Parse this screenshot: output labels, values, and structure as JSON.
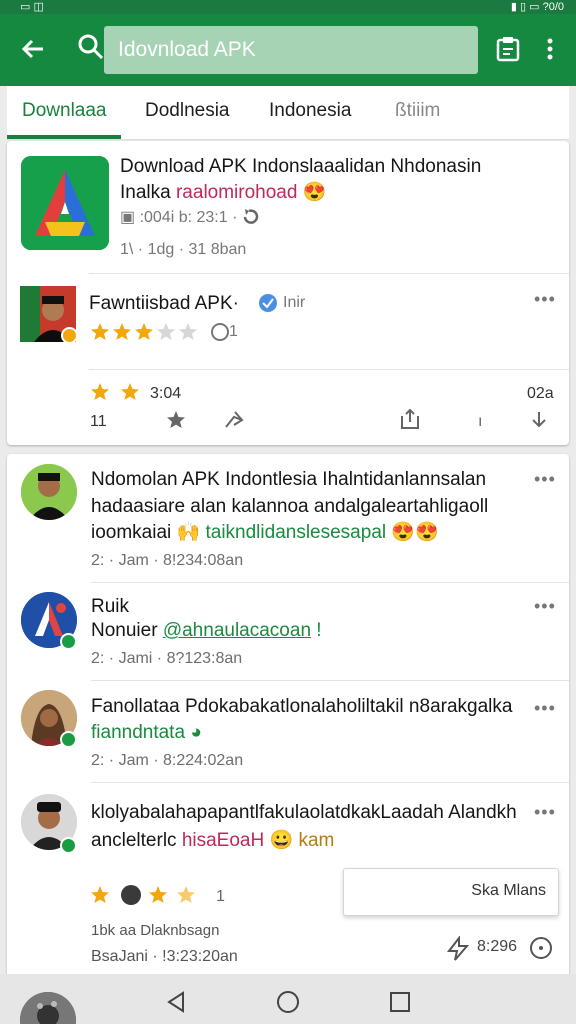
{
  "colors": {
    "brand": "#14893f",
    "accent": "#19813d",
    "pink": "#c0285a",
    "star": "#f2a80c"
  },
  "search": {
    "value": "Idovnload APK"
  },
  "tabs": [
    "Downlaaa",
    "Dodlnesia",
    "Indonesia",
    "ßtiiim"
  ],
  "app_card": {
    "title": "Download APK Indonslaaalidan Nhdonasin",
    "line2_a": "Inalka ",
    "line2_b": "raalomirohoad",
    "line3": "▣ :004i b: 23:1 ·",
    "line4": "1\\ · 1dg · 31 8ban",
    "post_title": "Fawntiisbad APK·",
    "post_title_suffix": "Inir",
    "rating_count": "1",
    "stat_label": "3:04",
    "stat_right": "02a",
    "action_left": "11",
    "action_right": "ı"
  },
  "posts": [
    {
      "line1": "Ndomolan APK Indontlesia Ihalntidanlannsalan",
      "line2": "hadaasiare alan kalannoa andalgaleartahligaoll",
      "line3_a": "ioomkaiai",
      "line3_b": "taikndlidanslesesapal",
      "meta": "2: · Jam · 8!234:08an"
    },
    {
      "line1": "Ruik",
      "line2_a": "Nonuier",
      "line2_b": "@ahnaulacacoan",
      "meta": "2: · Jami · 8?123:8an"
    },
    {
      "line1": "Fanollataa Pdokabakatlonalaholiltakil n8arakgalka",
      "line2": "fianndntata",
      "meta": "2: · Jam · 8:224:02an"
    },
    {
      "line1": "klolyabalahapapantlfakulaolatdkakLaadah Alandkh",
      "line2_a": "anclelterlc",
      "line2_b": "hisaEoaH",
      "line2_c": "kam",
      "rating_count": "1",
      "footer1": "1bk aa Dlaknbsagn",
      "footer2": "BsaJani · !3:23:20an",
      "stat": "8:296",
      "popup_label": "Ska Mlans"
    }
  ]
}
